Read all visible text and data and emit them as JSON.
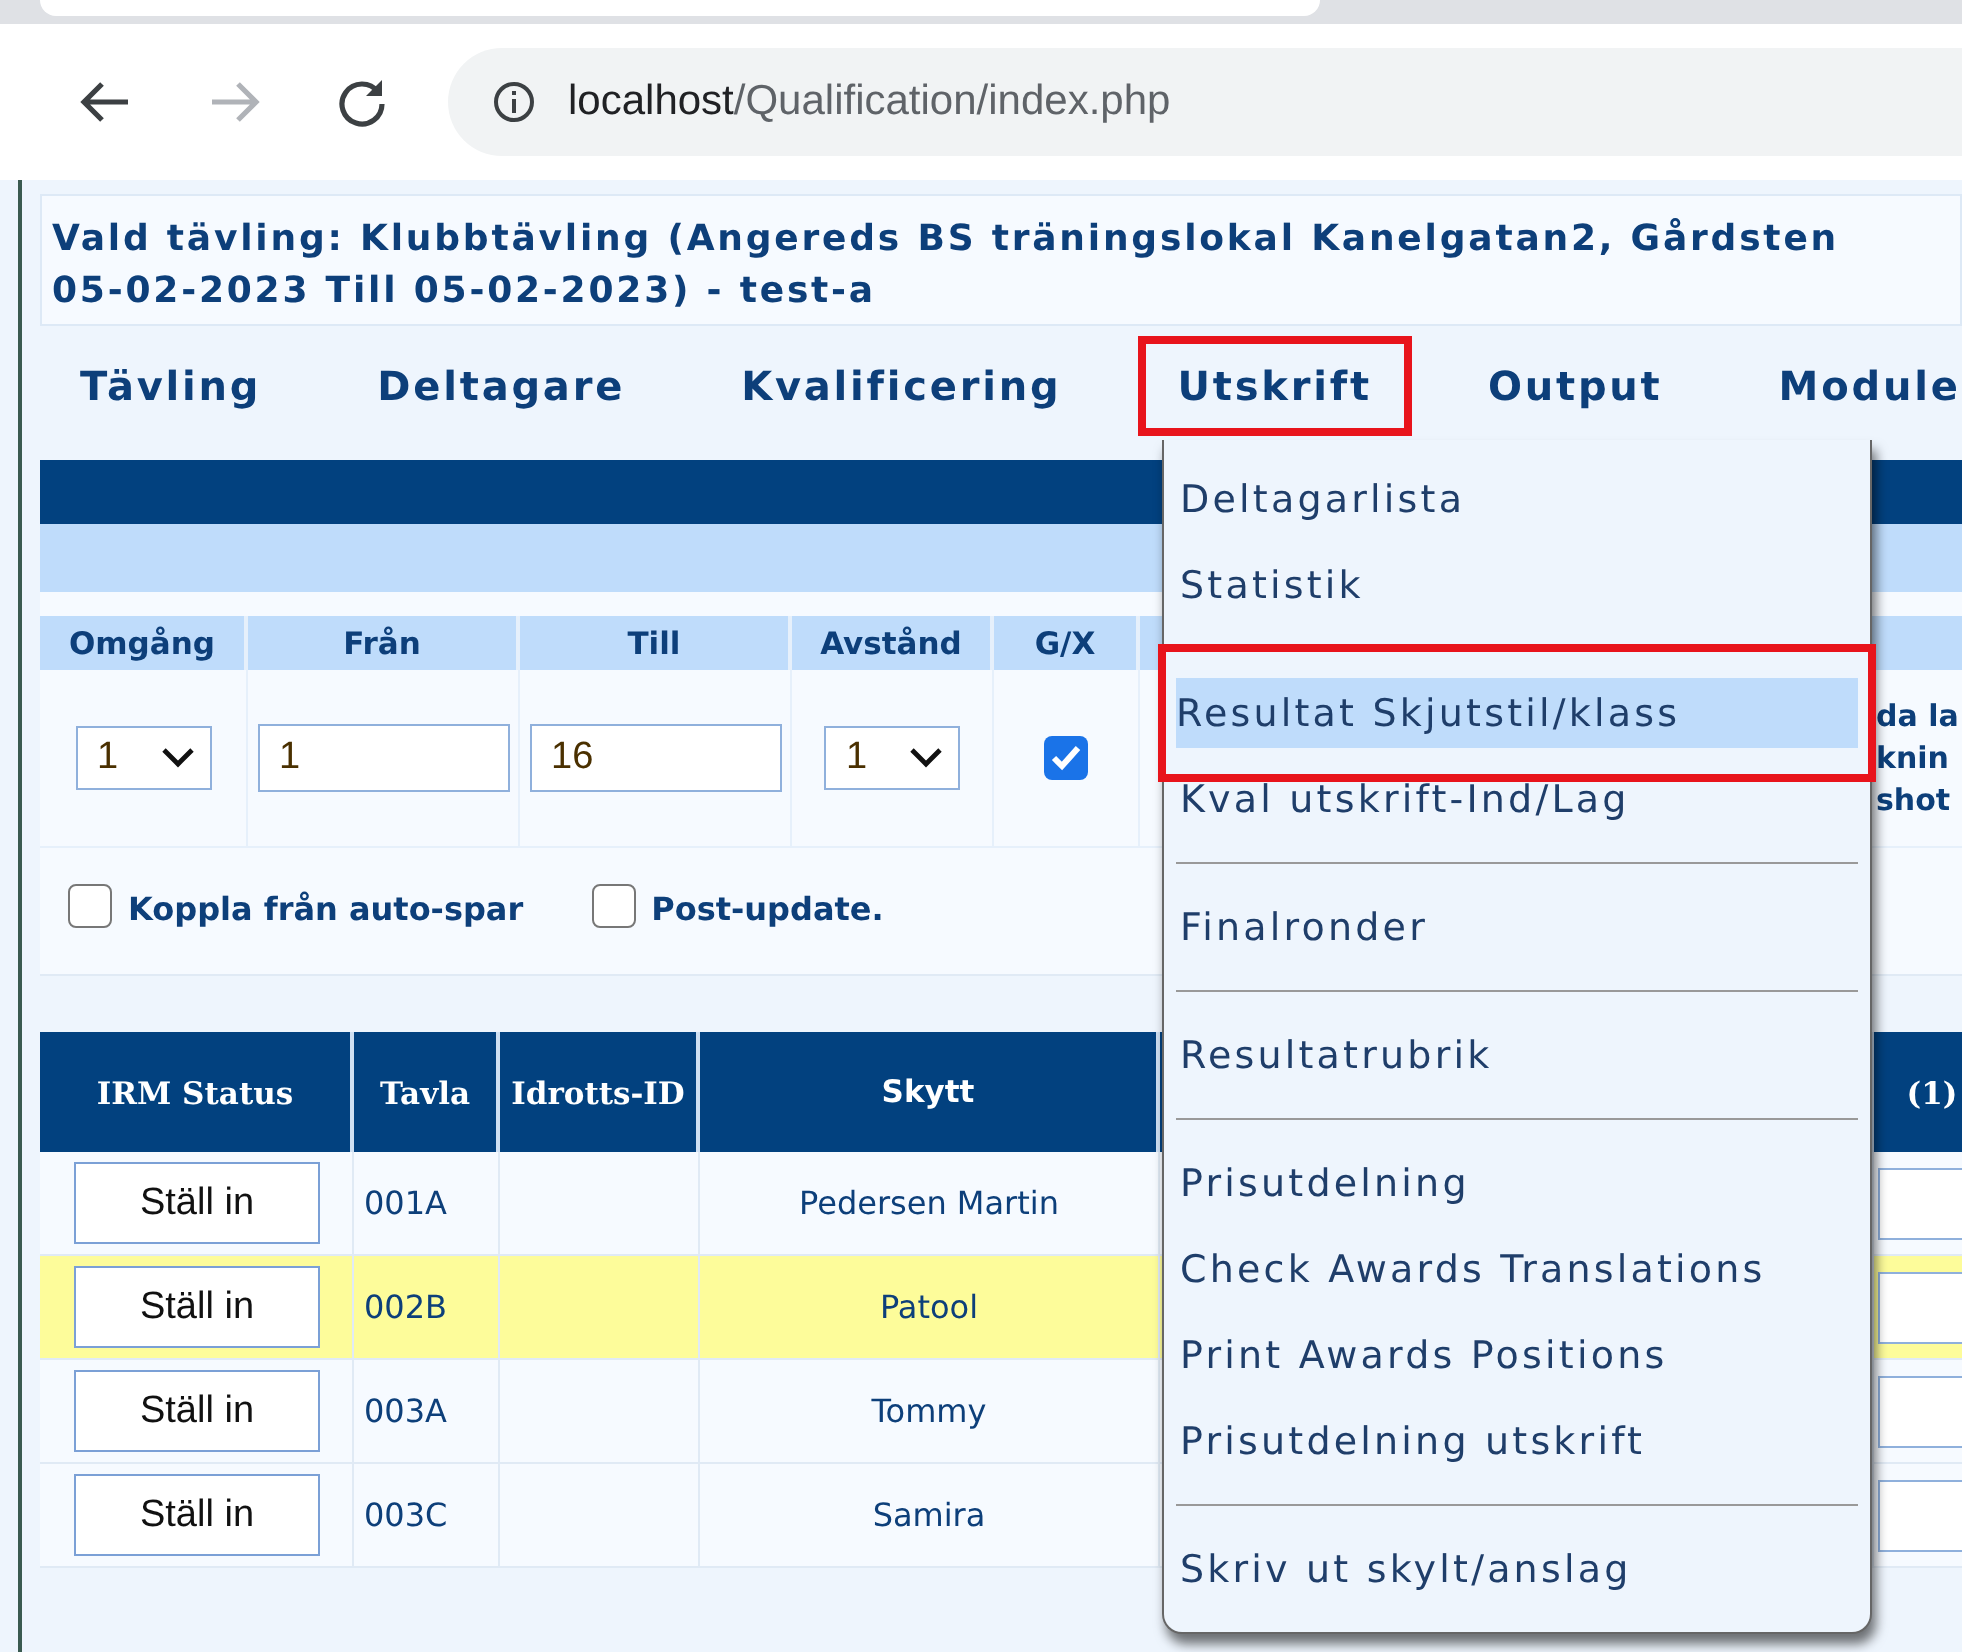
{
  "browser": {
    "url_host": "localhost",
    "url_path": "/Qualification/index.php",
    "forward_disabled": true
  },
  "competition": {
    "lines": [
      "Vald tävling: Klubbtävling (Angereds BS träningslokal Kanelgatan2, Gårdsten",
      "05-02-2023 Till 05-02-2023) - test-a"
    ]
  },
  "nav": [
    {
      "label": "Tävling",
      "annotated": false
    },
    {
      "label": "Deltagare",
      "annotated": false
    },
    {
      "label": "Kvalificering",
      "annotated": false
    },
    {
      "label": "Utskrift",
      "annotated": true
    },
    {
      "label": "Output",
      "annotated": false
    },
    {
      "label": "Module",
      "annotated": false
    }
  ],
  "form": {
    "columns": [
      {
        "label": "Omgång",
        "kind": "select",
        "value": "1"
      },
      {
        "label": "Från",
        "kind": "input",
        "value": "1"
      },
      {
        "label": "Till",
        "kind": "input",
        "value": "16"
      },
      {
        "label": "Avstånd",
        "kind": "select",
        "value": "1"
      },
      {
        "label": "G/X",
        "kind": "checkbox",
        "checked": true
      }
    ],
    "column_7_lines": [
      "da la",
      "knin",
      "shot"
    ],
    "options": [
      {
        "label": "Koppla från auto-spar",
        "checked": false
      },
      {
        "label": "Post-update.",
        "checked": false
      }
    ]
  },
  "results": {
    "columns": [
      "IRM Status",
      "Tavla",
      "Idrotts-ID",
      "Skytt"
    ],
    "column_6": "(1)",
    "rows": [
      {
        "button": "Ställ in",
        "tavla": "001A",
        "skytt": "Pedersen Martin",
        "highlighted": false
      },
      {
        "button": "Ställ in",
        "tavla": "002B",
        "skytt": "Patool",
        "highlighted": true
      },
      {
        "button": "Ställ in",
        "tavla": "003A",
        "skytt": "Tommy",
        "highlighted": false
      },
      {
        "button": "Ställ in",
        "tavla": "003C",
        "skytt": "Samira",
        "highlighted": false
      }
    ]
  },
  "menu": {
    "groups": [
      [
        {
          "label": "Deltagarlista",
          "selected": false,
          "annotated": false
        },
        {
          "label": "Statistik",
          "selected": false,
          "annotated": false
        }
      ],
      [
        {
          "label": "Resultat Skjutstil/klass",
          "selected": true,
          "annotated": true
        },
        {
          "label": "Kval utskrift-Ind/Lag",
          "selected": false,
          "annotated": false
        }
      ],
      [
        {
          "label": "Finalronder",
          "selected": false,
          "annotated": false
        }
      ],
      [
        {
          "label": "Resultatrubrik",
          "selected": false,
          "annotated": false
        }
      ],
      [
        {
          "label": "Prisutdelning",
          "selected": false,
          "annotated": false
        },
        {
          "label": "Check Awards Translations",
          "selected": false,
          "annotated": false
        },
        {
          "label": "Print Awards Positions",
          "selected": false,
          "annotated": false
        },
        {
          "label": "Prisutdelning utskrift",
          "selected": false,
          "annotated": false
        }
      ],
      [
        {
          "label": "Skriv ut skylt/anslag",
          "selected": false,
          "annotated": false
        }
      ]
    ]
  }
}
